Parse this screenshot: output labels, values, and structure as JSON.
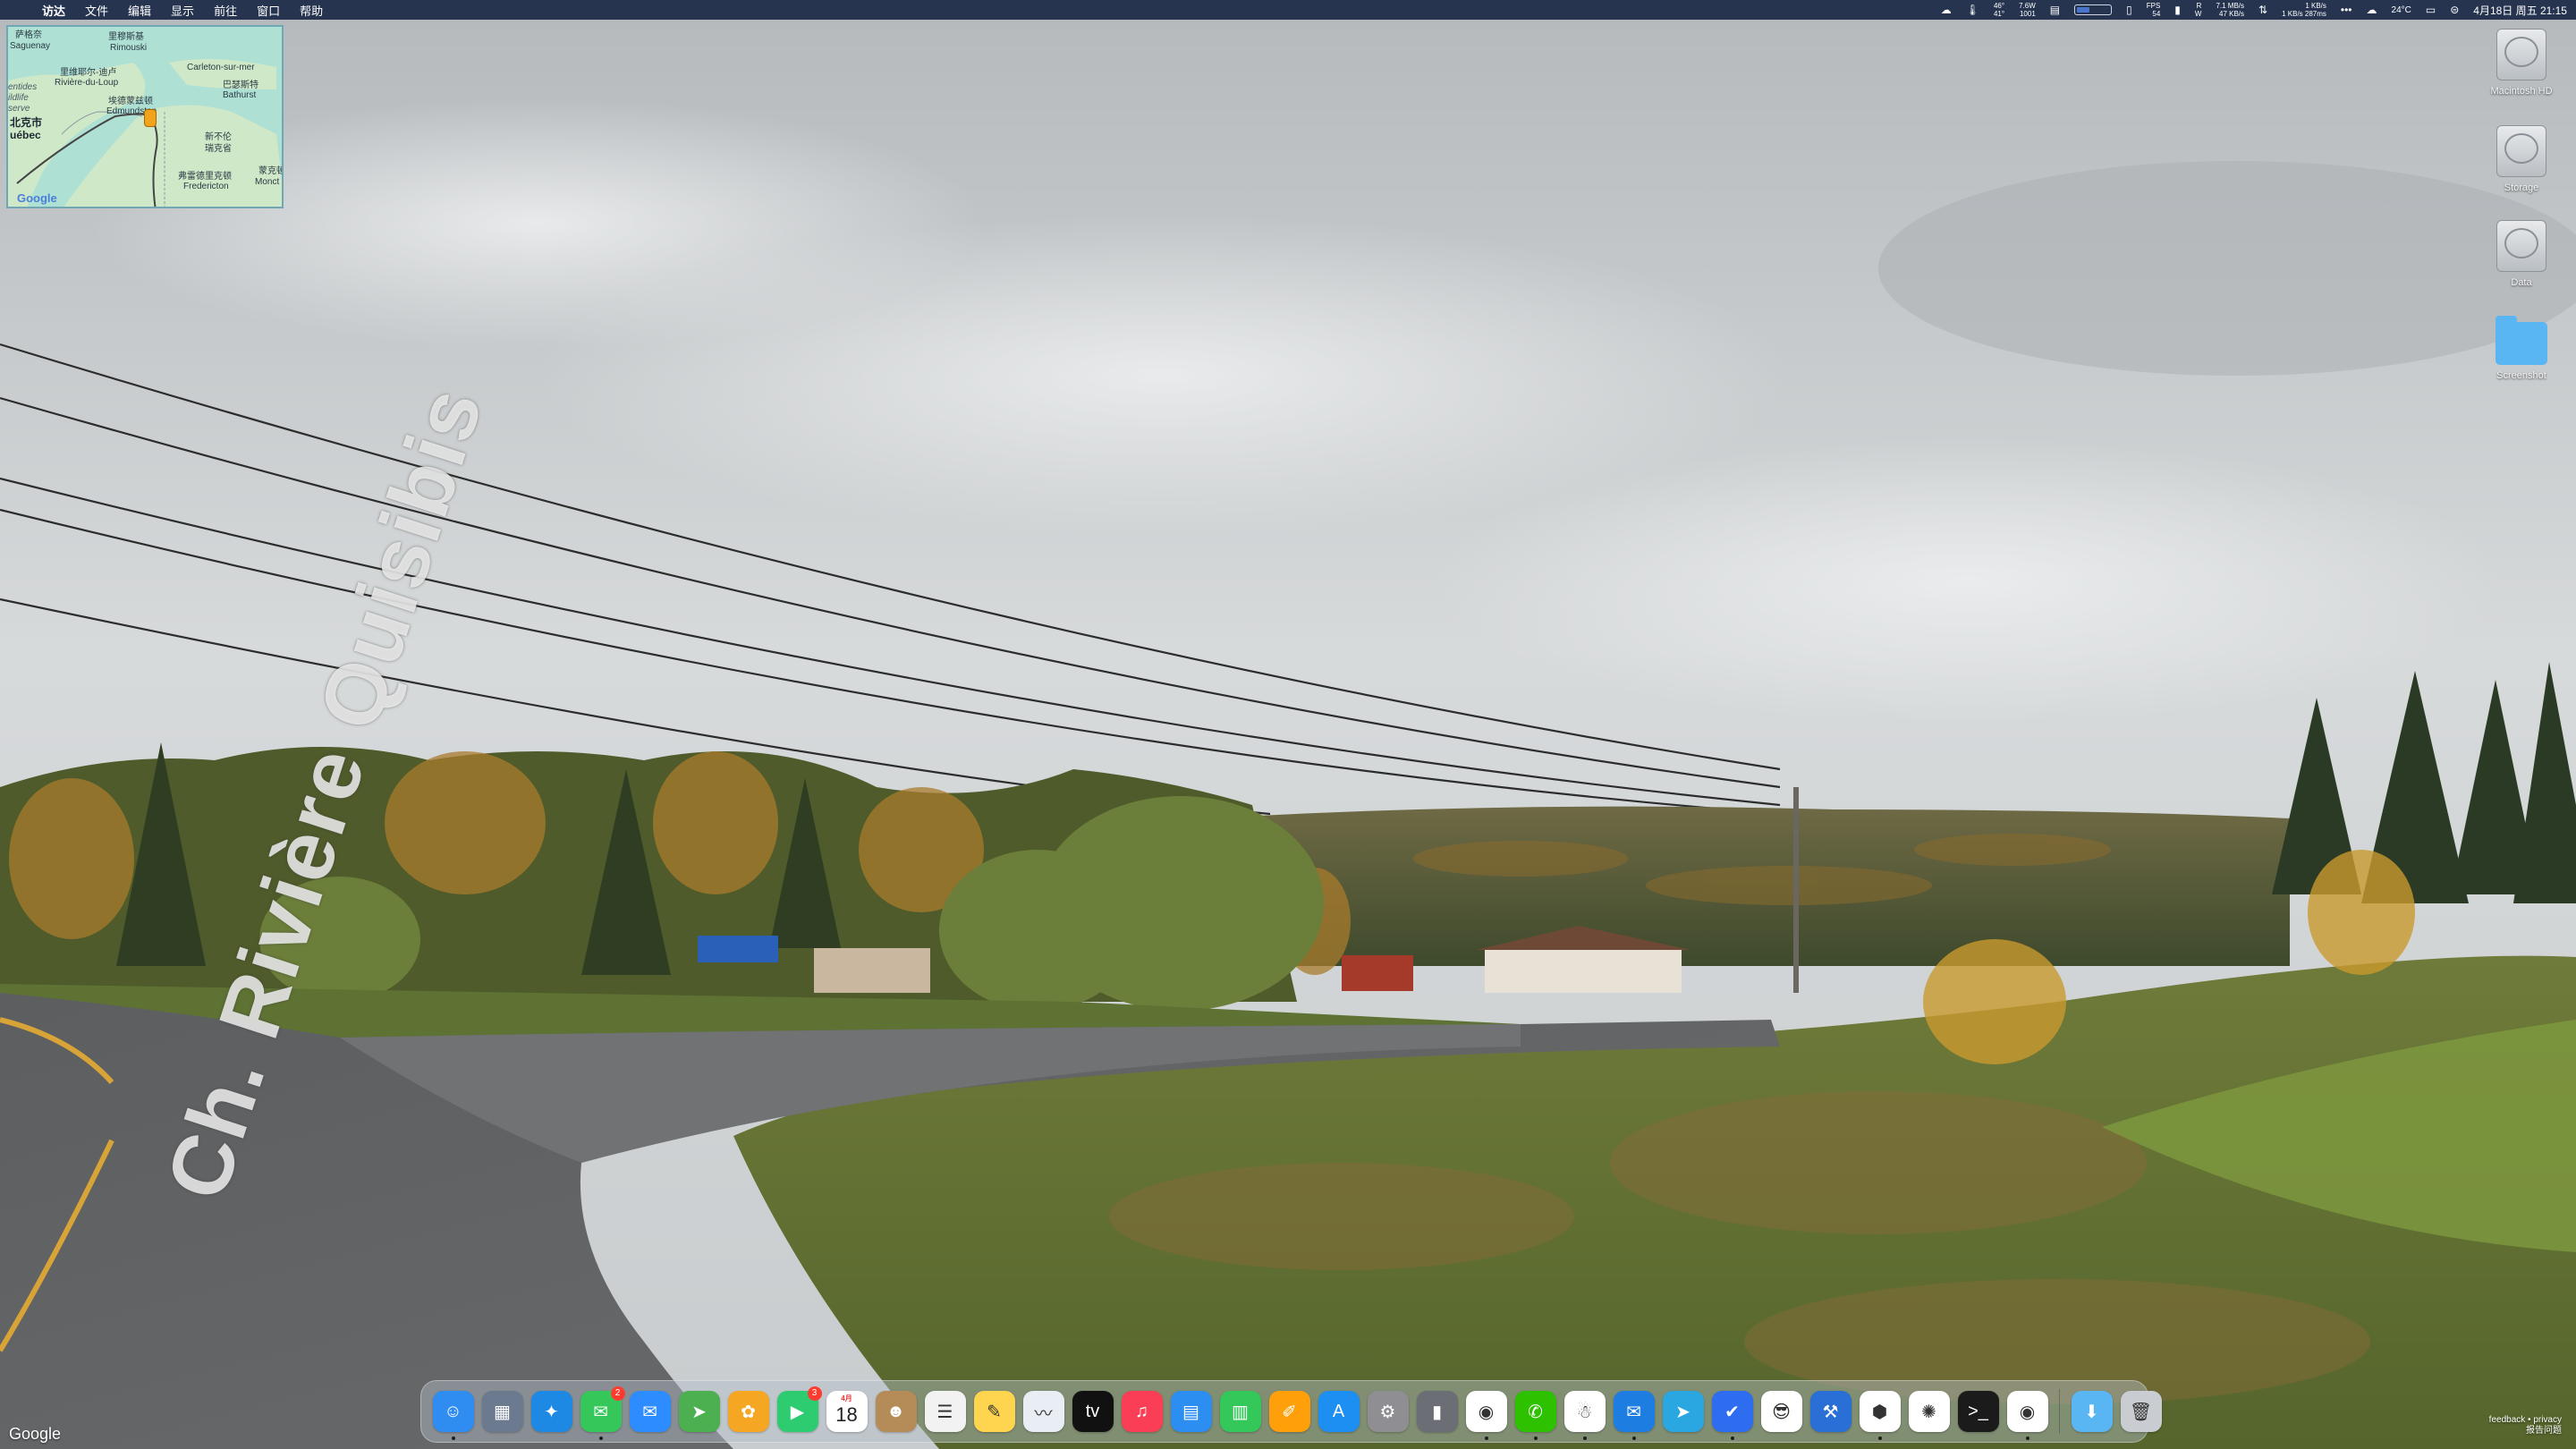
{
  "menubar": {
    "apple_icon": "",
    "app_name": "访达",
    "menus": [
      "文件",
      "编辑",
      "显示",
      "前往",
      "窗口",
      "帮助"
    ],
    "status": {
      "temp_top": "46°",
      "temp_bottom": "41°",
      "power_top": "7.6W",
      "power_bottom": "1001",
      "fps_label": "FPS",
      "fps_value": "54",
      "net_r": "R",
      "net_w": "W",
      "net_up": "7.1 MB/s",
      "net_down": "47 KB/s",
      "net2_up": "1 KB/s",
      "net2_down": "1 KB/s 287ms",
      "weather": "24°C",
      "clock": "4月18日 周五 21:15"
    }
  },
  "map_widget": {
    "labels": {
      "saguenay_cn": "萨格奈",
      "saguenay": "Saguenay",
      "rimouski_cn": "里穆斯基",
      "rimouski": "Rimouski",
      "riviere_cn": "里维耶尔-迪卢",
      "riviere": "Rivière-du-Loup",
      "carleton": "Carleton-sur-mer",
      "bathurst_cn": "巴瑟斯特",
      "bathurst": "Bathurst",
      "entides": "entides",
      "faune": "ildlife",
      "reserve": "serve",
      "quebec_cn": "北克市",
      "quebec": "uébec",
      "edmundston_cn": "埃德蒙兹顿",
      "edmundston": "Edmundston",
      "nb_cn1": "新不伦",
      "nb_cn2": "瑞克省",
      "fredericton_cn": "弗雷德里克顿",
      "fredericton": "Fredericton",
      "moncton_cn": "蒙克顿",
      "moncton": "Monct"
    },
    "google": "Google"
  },
  "desktop_icons": [
    {
      "label": "Macintosh HD",
      "kind": "disk"
    },
    {
      "label": "Storage",
      "kind": "disk"
    },
    {
      "label": "Data",
      "kind": "disk"
    },
    {
      "label": "Screenshot",
      "kind": "folder"
    }
  ],
  "wallpaper": {
    "road_text": "Ch. Rivière Quisibis",
    "google_mark": "Google",
    "feedback_line1": "feedback • privacy",
    "feedback_line2": "报告问题"
  },
  "dock": {
    "apps": [
      {
        "name": "finder",
        "icon": "☺",
        "color": "#2f8cf0",
        "running": true
      },
      {
        "name": "launchpad",
        "icon": "▦",
        "color": "#6c7a90"
      },
      {
        "name": "safari",
        "icon": "✦",
        "color": "#1e88e5"
      },
      {
        "name": "messages",
        "icon": "✉",
        "color": "#35c759",
        "badge": "2",
        "running": true
      },
      {
        "name": "mail",
        "icon": "✉",
        "color": "#2d8cff"
      },
      {
        "name": "maps",
        "icon": "➤",
        "color": "#4caf50"
      },
      {
        "name": "photos",
        "icon": "✿",
        "color": "#f5a623"
      },
      {
        "name": "facetime",
        "icon": "▶",
        "color": "#2ecc71",
        "badge": "3"
      },
      {
        "name": "calendar",
        "icon": "",
        "color": "#ffffff",
        "calendar_day": "18",
        "calendar_month": "4月"
      },
      {
        "name": "contacts",
        "icon": "☻",
        "color": "#b58b58"
      },
      {
        "name": "reminders",
        "icon": "☰",
        "color": "#f2f2f2"
      },
      {
        "name": "notes",
        "icon": "✎",
        "color": "#ffd54f"
      },
      {
        "name": "freeform",
        "icon": "〰",
        "color": "#e9eef5"
      },
      {
        "name": "tv",
        "icon": "tv",
        "color": "#111111"
      },
      {
        "name": "music",
        "icon": "♫",
        "color": "#fa3e55"
      },
      {
        "name": "keynote",
        "icon": "▤",
        "color": "#2b8ef0"
      },
      {
        "name": "numbers",
        "icon": "▥",
        "color": "#34c759"
      },
      {
        "name": "pages",
        "icon": "✐",
        "color": "#ff9f0a"
      },
      {
        "name": "app-store",
        "icon": "A",
        "color": "#1d8ef2"
      },
      {
        "name": "system-settings",
        "icon": "⚙",
        "color": "#8e8e93"
      },
      {
        "name": "terminal-alt",
        "icon": "▮",
        "color": "#6b6f75"
      },
      {
        "name": "chrome",
        "icon": "◉",
        "color": "#ffffff",
        "running": true
      },
      {
        "name": "wechat",
        "icon": "✆",
        "color": "#2dc100",
        "running": true
      },
      {
        "name": "qq",
        "icon": "☃",
        "color": "#ffffff",
        "running": true
      },
      {
        "name": "feedback",
        "icon": "✉",
        "color": "#1e7de0",
        "running": true
      },
      {
        "name": "telegram",
        "icon": "➤",
        "color": "#2aa6e0"
      },
      {
        "name": "mail-alt",
        "icon": "✔",
        "color": "#2f6df0",
        "running": true
      },
      {
        "name": "emoji",
        "icon": "😎",
        "color": "#ffffff"
      },
      {
        "name": "xcode",
        "icon": "⚒",
        "color": "#2a6fd6"
      },
      {
        "name": "cube",
        "icon": "⬢",
        "color": "#ffffff",
        "running": true
      },
      {
        "name": "chatgpt",
        "icon": "✺",
        "color": "#ffffff"
      },
      {
        "name": "terminal",
        "icon": ">_",
        "color": "#1b1b1b"
      },
      {
        "name": "chrome-alt",
        "icon": "◉",
        "color": "#ffffff",
        "running": true
      }
    ],
    "right_items": [
      {
        "name": "downloads-folder",
        "icon": "⬇",
        "color": "#5ab6f2"
      },
      {
        "name": "trash",
        "icon": "🗑",
        "color": "#c9ccd0"
      }
    ]
  }
}
